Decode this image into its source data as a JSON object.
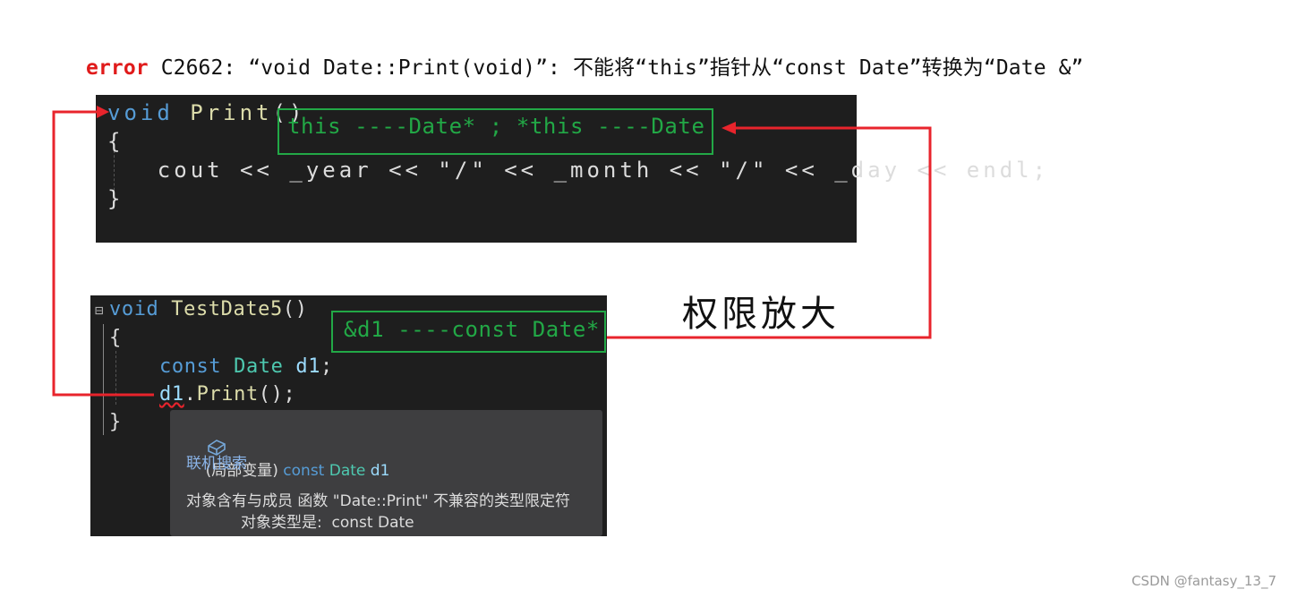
{
  "error_line": {
    "keyword": "error",
    "message": " C2662: “void Date::Print(void)”: 不能将“this”指针从“const Date”转换为“Date &”"
  },
  "code_print": {
    "line1": {
      "kw": "void",
      "name": "Print",
      "rest": "()"
    },
    "line2": "{",
    "line3": "    cout << _year << \"/\" << _month << \"/\" << _day << endl;",
    "line4": "}"
  },
  "annotation_this": "this ----Date* ; *this ----Date",
  "code_test": {
    "fold": "⊟",
    "line1": {
      "kw": "void",
      "name": "TestDate5",
      "rest": "()"
    },
    "line2": "{",
    "line3": {
      "kw": "const",
      "type": "Date",
      "var": "d1",
      "end": ";"
    },
    "line4": {
      "var": "d1",
      "dot": ".",
      "fn": "Print",
      "end": "();"
    },
    "line5": "}"
  },
  "annotation_d1": "&d1 ----const Date*",
  "annotation_note": "权限放大",
  "tooltip": {
    "icon": "local-variable-cube-icon",
    "prefix": "(局部变量) ",
    "kw": "const",
    "type": "Date",
    "var": "d1",
    "search_link": "联机搜索",
    "message": "对象含有与成员 函数 \"Date::Print\" 不兼容的类型限定符",
    "detail": "对象类型是:  const Date"
  },
  "watermark": "CSDN @fantasy_13_7",
  "colors": {
    "arrow": "#e8242c",
    "box": "#22a846",
    "editor_bg": "#1e1e1e"
  }
}
